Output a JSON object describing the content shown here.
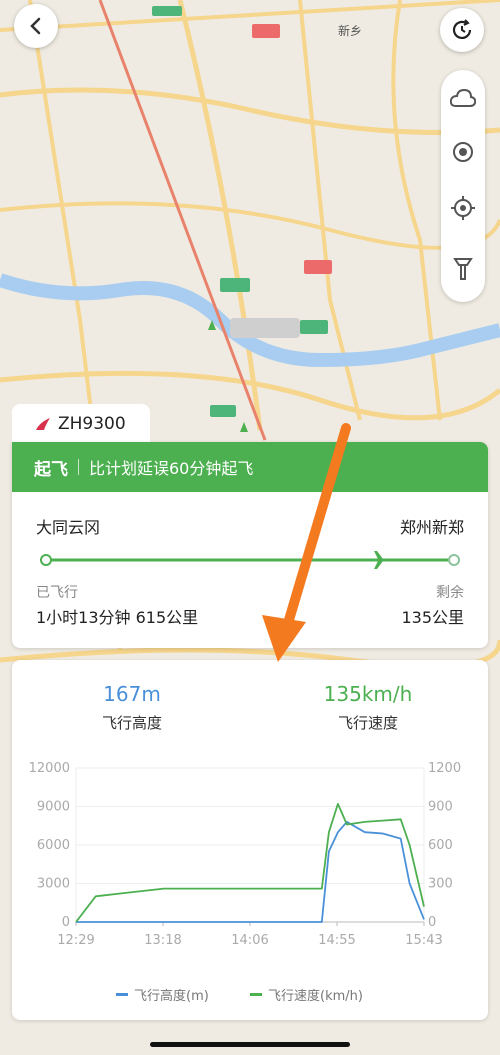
{
  "map": {
    "labels": [
      {
        "name": "map-label-xinxiang",
        "text": "新乡"
      }
    ]
  },
  "flight": {
    "number": "ZH9300",
    "status": "起飞",
    "status_note": "比计划延误60分钟起飞",
    "origin": "大同云冈",
    "destination": "郑州新郑",
    "flown_label": "已飞行",
    "flown_value": "1小时13分钟 615公里",
    "remaining_label": "剩余",
    "remaining_value": "135公里",
    "progress": 0.82
  },
  "metrics": {
    "altitude_value": "167m",
    "altitude_label": "飞行高度",
    "speed_value": "135km/h",
    "speed_label": "飞行速度"
  },
  "colors": {
    "green": "#4caf50",
    "blue": "#4a90d9",
    "orange": "#f47a20"
  },
  "chart_data": {
    "type": "line",
    "x": [
      "12:29",
      "12:40",
      "13:18",
      "14:06",
      "14:46",
      "14:50",
      "14:55",
      "15:00",
      "15:10",
      "15:20",
      "15:30",
      "15:35",
      "15:43"
    ],
    "x_ticks": [
      "12:29",
      "13:18",
      "14:06",
      "14:55",
      "15:43"
    ],
    "y_left_ticks": [
      "0",
      "3000",
      "6000",
      "9000",
      "12000"
    ],
    "y_right_ticks": [
      "0",
      "300",
      "600",
      "900",
      "1200"
    ],
    "ylim_left": [
      0,
      12000
    ],
    "ylim_right": [
      0,
      1200
    ],
    "series": [
      {
        "name": "飞行高度(m)",
        "axis": "left",
        "color": "#4a90d9",
        "values": [
          0,
          0,
          0,
          0,
          0,
          5500,
          7000,
          7800,
          7000,
          6900,
          6500,
          3000,
          200
        ]
      },
      {
        "name": "飞行速度(km/h)",
        "axis": "right",
        "color": "#4caf50",
        "values": [
          0,
          200,
          260,
          260,
          260,
          700,
          920,
          760,
          780,
          790,
          800,
          600,
          120
        ]
      }
    ],
    "grid": true,
    "legend": "bottom"
  },
  "legend": {
    "altitude": "飞行高度(m)",
    "speed": "飞行速度(km/h)"
  }
}
